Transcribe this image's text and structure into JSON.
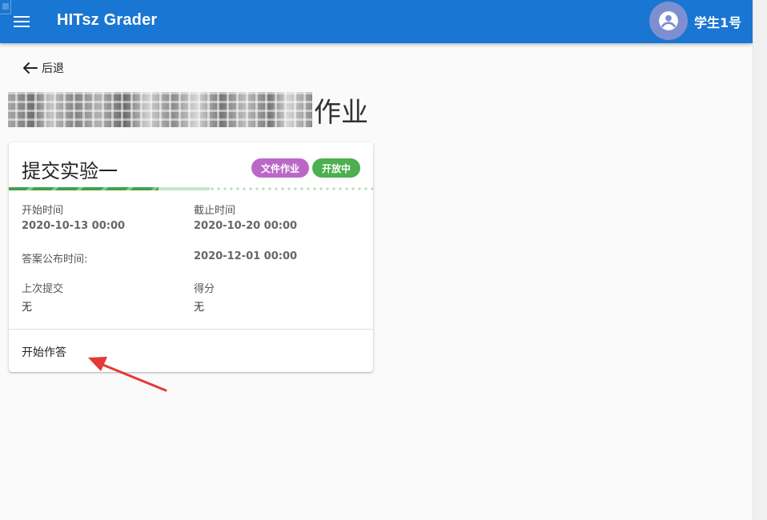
{
  "app_bar": {
    "title": "HITsz Grader",
    "username": "学生1号",
    "menu_icon": "menu-icon",
    "avatar_icon": "account-circle-icon",
    "color": "#1976d2"
  },
  "nav": {
    "back_label": "后退",
    "back_icon": "arrow-left-icon"
  },
  "page": {
    "title_suffix": "作业"
  },
  "assignment": {
    "title": "提交实验一",
    "type_chip": "文件作业",
    "status_chip": "开放中",
    "type_chip_color": "#ba68c8",
    "status_chip_color": "#4caf50",
    "progress": 0.41,
    "buffer": 0.55,
    "fields": {
      "start_label": "开始时间",
      "start_value": "2020-10-13 00:00",
      "end_label": "截止时间",
      "end_value": "2020-10-20 00:00",
      "answer_label": "答案公布时间:",
      "answer_value": "2020-12-01 00:00",
      "last_submit_label": "上次提交",
      "last_submit_value": "无",
      "score_label": "得分",
      "score_value": "无"
    },
    "action_label": "开始作答"
  },
  "annotation": {
    "arrow_color": "#e53935"
  }
}
